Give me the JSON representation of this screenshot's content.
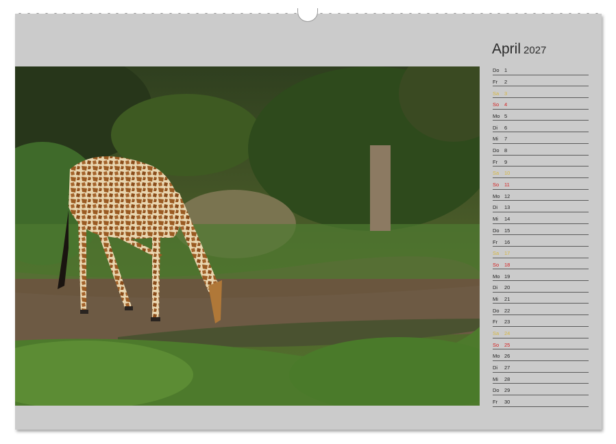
{
  "calendar": {
    "month": "April",
    "year": "2027",
    "days": [
      {
        "wd": "Do",
        "d": "1",
        "type": "weekday"
      },
      {
        "wd": "Fr",
        "d": "2",
        "type": "weekday"
      },
      {
        "wd": "Sa",
        "d": "3",
        "type": "saturday"
      },
      {
        "wd": "So",
        "d": "4",
        "type": "sunday"
      },
      {
        "wd": "Mo",
        "d": "5",
        "type": "weekday"
      },
      {
        "wd": "Di",
        "d": "6",
        "type": "weekday"
      },
      {
        "wd": "Mi",
        "d": "7",
        "type": "weekday"
      },
      {
        "wd": "Do",
        "d": "8",
        "type": "weekday"
      },
      {
        "wd": "Fr",
        "d": "9",
        "type": "weekday"
      },
      {
        "wd": "Sa",
        "d": "10",
        "type": "saturday"
      },
      {
        "wd": "So",
        "d": "11",
        "type": "sunday"
      },
      {
        "wd": "Mo",
        "d": "12",
        "type": "weekday"
      },
      {
        "wd": "Di",
        "d": "13",
        "type": "weekday"
      },
      {
        "wd": "Mi",
        "d": "14",
        "type": "weekday"
      },
      {
        "wd": "Do",
        "d": "15",
        "type": "weekday"
      },
      {
        "wd": "Fr",
        "d": "16",
        "type": "weekday"
      },
      {
        "wd": "Sa",
        "d": "17",
        "type": "saturday"
      },
      {
        "wd": "So",
        "d": "18",
        "type": "sunday"
      },
      {
        "wd": "Mo",
        "d": "19",
        "type": "weekday"
      },
      {
        "wd": "Di",
        "d": "20",
        "type": "weekday"
      },
      {
        "wd": "Mi",
        "d": "21",
        "type": "weekday"
      },
      {
        "wd": "Do",
        "d": "22",
        "type": "weekday"
      },
      {
        "wd": "Fr",
        "d": "23",
        "type": "weekday"
      },
      {
        "wd": "Sa",
        "d": "24",
        "type": "saturday"
      },
      {
        "wd": "So",
        "d": "25",
        "type": "sunday"
      },
      {
        "wd": "Mo",
        "d": "26",
        "type": "weekday"
      },
      {
        "wd": "Di",
        "d": "27",
        "type": "weekday"
      },
      {
        "wd": "Mi",
        "d": "28",
        "type": "weekday"
      },
      {
        "wd": "Do",
        "d": "29",
        "type": "weekday"
      },
      {
        "wd": "Fr",
        "d": "30",
        "type": "weekday"
      }
    ]
  },
  "colors": {
    "page": "#cbcbcb",
    "saturday": "#d6b640",
    "sunday": "#d42222"
  }
}
